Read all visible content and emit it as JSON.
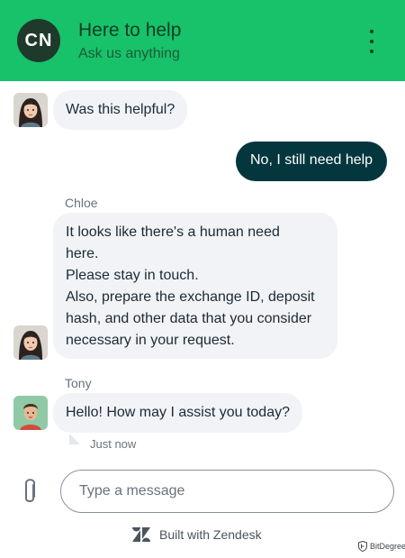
{
  "header": {
    "logo_text": "CN",
    "title": "Here to help",
    "subtitle": "Ask us anything",
    "background_color": "#17c26a"
  },
  "messages": [
    {
      "type": "bot",
      "avatar": "agent-woman-avatar",
      "text": "Was this helpful?"
    },
    {
      "type": "user",
      "text": "No, I still need help",
      "color": "#04363d"
    },
    {
      "type": "agent",
      "sender": "Chloe",
      "avatar": "agent-woman-avatar",
      "lines": [
        "It looks like there's a human need",
        "here.",
        "Please stay in touch.",
        "Also, prepare the exchange ID, deposit",
        "hash, and other data that you consider",
        "necessary in your request."
      ]
    },
    {
      "type": "agent",
      "sender": "Tony",
      "avatar": "agent-man-avatar",
      "text": "Hello! How may I assist you today?",
      "timestamp": "Just now"
    }
  ],
  "composer": {
    "placeholder": "Type a message",
    "attach_icon": "paperclip-icon"
  },
  "footer": {
    "text": "Built with Zendesk",
    "icon": "zendesk-logo-icon"
  },
  "watermark": {
    "text": "BitDegree"
  }
}
